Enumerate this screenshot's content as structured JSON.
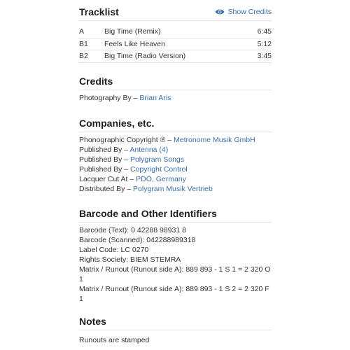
{
  "tracklist": {
    "title": "Tracklist",
    "show_credits": "Show Credits",
    "tracks": [
      {
        "pos": "A",
        "title": "Big Time (Remix)",
        "duration": "6:45"
      },
      {
        "pos": "B1",
        "title": "Feels Like Heaven",
        "duration": "5:12"
      },
      {
        "pos": "B2",
        "title": "Big Time (Radio Version)",
        "duration": "3:45"
      }
    ]
  },
  "credits": {
    "title": "Credits",
    "items": [
      {
        "role": "Photography By – ",
        "name": "Brian Aris"
      }
    ]
  },
  "companies": {
    "title": "Companies, etc.",
    "items": [
      {
        "role": "Phonographic Copyright ℗ – ",
        "name": "Metronome Musik GmbH"
      },
      {
        "role": "Published By – ",
        "name": "Antenna (4)"
      },
      {
        "role": "Published By – ",
        "name": "Polygram Songs"
      },
      {
        "role": "Published By – ",
        "name": "Copyright Control"
      },
      {
        "role": "Lacquer Cut At – ",
        "name": "PDO, Germany"
      },
      {
        "role": "Distributed By – ",
        "name": "Polygram Musik Vertrieb"
      }
    ]
  },
  "identifiers": {
    "title": "Barcode and Other Identifiers",
    "items": [
      {
        "text": "Barcode (Text): 0 42288 98931 8"
      },
      {
        "text": "Barcode (Scanned): 042288989318"
      },
      {
        "text": "Label Code: LC 0270"
      },
      {
        "text": "Rights Society: BIEM STEMRA"
      },
      {
        "text": "Matrix / Runout (Runout side A): 889 893 - 1 S 1 = 2 320 O 1"
      },
      {
        "text": "Matrix / Runout (Runout side A): 889 893 - 1 S 2 = 2 320 F 1"
      }
    ]
  },
  "notes": {
    "title": "Notes",
    "text": "Runouts are stamped"
  },
  "colors": {
    "link": "#3a6ea8",
    "text": "#333333",
    "heading": "#202020"
  }
}
